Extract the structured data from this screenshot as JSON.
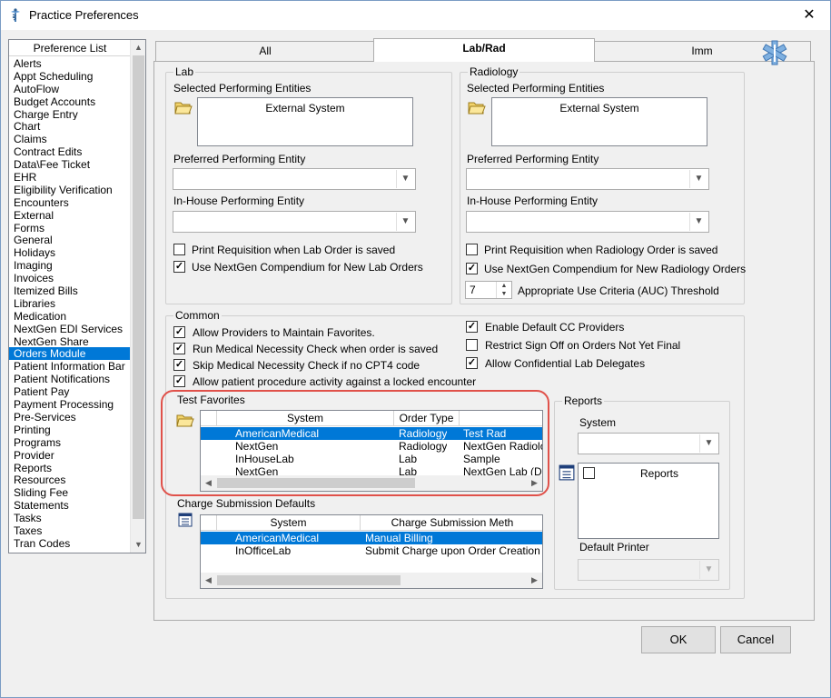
{
  "window": {
    "title": "Practice Preferences",
    "title_icon": "caduceus-icon",
    "close_glyph": "✕"
  },
  "preference_list": {
    "header": "Preference List",
    "items": [
      "Alerts",
      "Appt Scheduling",
      "AutoFlow",
      "Budget Accounts",
      "Charge Entry",
      "Chart",
      "Claims",
      "Contract Edits",
      "Data\\Fee Ticket",
      "EHR",
      "Eligibility Verification",
      "Encounters",
      "External",
      "Forms",
      "General",
      "Holidays",
      "Imaging",
      "Invoices",
      "Itemized Bills",
      "Libraries",
      "Medication",
      "NextGen EDI Services",
      "NextGen Share",
      "Orders Module",
      "Patient Information Bar",
      "Patient Notifications",
      "Patient Pay",
      "Payment Processing",
      "Pre-Services",
      "Printing",
      "Programs",
      "Provider",
      "Reports",
      "Resources",
      "Sliding Fee",
      "Statements",
      "Tasks",
      "Taxes",
      "Tran Codes"
    ],
    "selected": "Orders Module"
  },
  "tabs": [
    {
      "label": "All",
      "active": false
    },
    {
      "label": "Lab/Rad",
      "active": true
    },
    {
      "label": "Imm",
      "active": false
    }
  ],
  "lab": {
    "title": "Lab",
    "selected_entities_label": "Selected Performing Entities",
    "selected_entities": [
      "External System"
    ],
    "preferred_label": "Preferred Performing Entity",
    "preferred_value": "",
    "inhouse_label": "In-House Performing Entity",
    "inhouse_value": "",
    "print_req_label": "Print Requisition when Lab Order is saved",
    "print_req_checked": false,
    "compendium_label": "Use NextGen Compendium for New Lab Orders",
    "compendium_checked": true
  },
  "radiology": {
    "title": "Radiology",
    "selected_entities_label": "Selected Performing Entities",
    "selected_entities": [
      "External System"
    ],
    "preferred_label": "Preferred Performing Entity",
    "preferred_value": "",
    "inhouse_label": "In-House Performing Entity",
    "inhouse_value": "",
    "print_req_label": "Print Requisition when Radiology Order is saved",
    "print_req_checked": false,
    "compendium_label": "Use NextGen Compendium for New Radiology Orders",
    "compendium_checked": true,
    "auc_value": "7",
    "auc_label": "Appropriate Use Criteria (AUC) Threshold"
  },
  "common": {
    "title": "Common",
    "options_left": [
      {
        "label": "Allow Providers to Maintain Favorites.",
        "checked": true
      },
      {
        "label": "Run Medical Necessity Check when order is saved",
        "checked": true
      },
      {
        "label": "Skip Medical Necessity Check if no CPT4 code",
        "checked": true
      },
      {
        "label": "Allow patient procedure activity against a locked encounter",
        "checked": true
      }
    ],
    "options_right": [
      {
        "label": "Enable Default CC Providers",
        "checked": true
      },
      {
        "label": "Restrict Sign Off on Orders Not Yet Final",
        "checked": false
      },
      {
        "label": "Allow Confidential Lab Delegates",
        "checked": true
      }
    ]
  },
  "test_favorites": {
    "title": "Test Favorites",
    "columns": [
      "System",
      "Order Type",
      ""
    ],
    "rows": [
      {
        "system": "AmericanMedical",
        "order_type": "Radiology",
        "name": "Test Rad",
        "selected": true
      },
      {
        "system": "NextGen",
        "order_type": "Radiology",
        "name": "NextGen Radiolo",
        "selected": false
      },
      {
        "system": "InHouseLab",
        "order_type": "Lab",
        "name": "Sample",
        "selected": false
      },
      {
        "system": "NextGen",
        "order_type": "Lab",
        "name": "NextGen Lab (De",
        "selected": false
      }
    ]
  },
  "charge_submission": {
    "title": "Charge Submission Defaults",
    "columns": [
      "System",
      "Charge Submission Meth"
    ],
    "rows": [
      {
        "system": "AmericanMedical",
        "method": "Manual Billing",
        "selected": true
      },
      {
        "system": "InOfficeLab",
        "method": "Submit Charge upon Order Creation",
        "selected": false
      }
    ]
  },
  "reports": {
    "title": "Reports",
    "system_label": "System",
    "system_value": "",
    "list_header": "Reports",
    "default_printer_label": "Default Printer",
    "default_printer_value": ""
  },
  "buttons": {
    "ok": "OK",
    "cancel": "Cancel"
  },
  "colors": {
    "selection": "#0078d7",
    "highlight_annotation": "#e0514a"
  }
}
